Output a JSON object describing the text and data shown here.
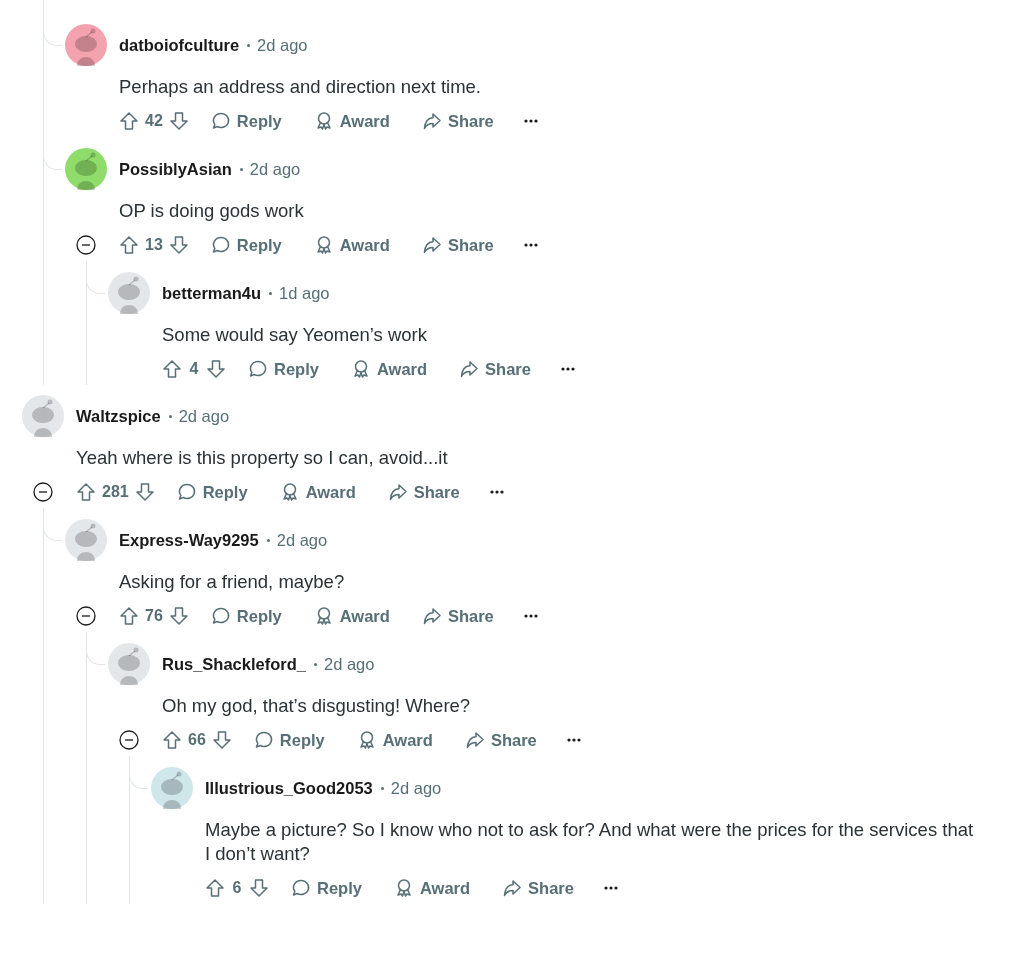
{
  "comments": [
    {
      "children": [
        {
          "author": "datboiofculture",
          "time": "2d ago",
          "color": "#f4a3ae",
          "body": "Perhaps an address and direction next time.",
          "score": "42",
          "actions": [
            "Reply",
            "Award",
            "Share"
          ]
        },
        {
          "author": "PossiblyAsian",
          "time": "2d ago",
          "color": "#8fdc6a",
          "body": "OP is doing gods work",
          "score": "13",
          "expanded": true,
          "actions": [
            "Reply",
            "Award",
            "Share"
          ],
          "children": [
            {
              "author": "betterman4u",
              "time": "1d ago",
              "color": "#e4e7ea",
              "body": "Some would say Yeomen’s work",
              "score": "4",
              "actions": [
                "Reply",
                "Award",
                "Share"
              ]
            }
          ]
        }
      ]
    },
    {
      "author": "Waltzspice",
      "time": "2d ago",
      "color": "#e4e7ea",
      "body": "Yeah where is this property so I can, avoid...it",
      "score": "281",
      "expanded": true,
      "actions": [
        "Reply",
        "Award",
        "Share"
      ],
      "children": [
        {
          "author": "Express-Way9295",
          "time": "2d ago",
          "color": "#e4e7ea",
          "body": "Asking for a friend, maybe?",
          "score": "76",
          "expanded": true,
          "actions": [
            "Reply",
            "Award",
            "Share"
          ],
          "children": [
            {
              "author": "Rus_Shackleford_",
              "time": "2d ago",
              "color": "#e4e7ea",
              "body": "Oh my god, that’s disgusting! Where?",
              "score": "66",
              "expanded": true,
              "actions": [
                "Reply",
                "Award",
                "Share"
              ],
              "children": [
                {
                  "author": "Illustrious_Good2053",
                  "time": "2d ago",
                  "color": "#cfe6ea",
                  "body": "Maybe a picture? So I know who not to ask for? And what were the prices for the services that I don’t want?",
                  "score": "6",
                  "actions": [
                    "Reply",
                    "Award",
                    "Share"
                  ]
                }
              ]
            }
          ]
        }
      ]
    }
  ]
}
